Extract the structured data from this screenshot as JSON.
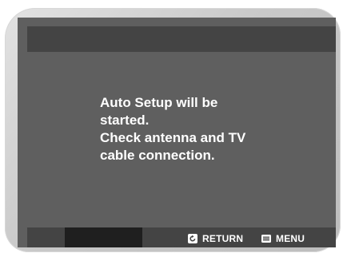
{
  "message": {
    "lines": [
      "Auto Setup will be",
      "started.",
      "Check antenna and TV",
      "cable connection."
    ]
  },
  "footer": {
    "return_label": "RETURN",
    "menu_label": "MENU",
    "return_icon": "return-icon",
    "menu_icon": "menu-icon"
  },
  "colors": {
    "screen_bg": "#5f5f5f",
    "bar_bg": "#444444",
    "text": "#ffffff"
  }
}
